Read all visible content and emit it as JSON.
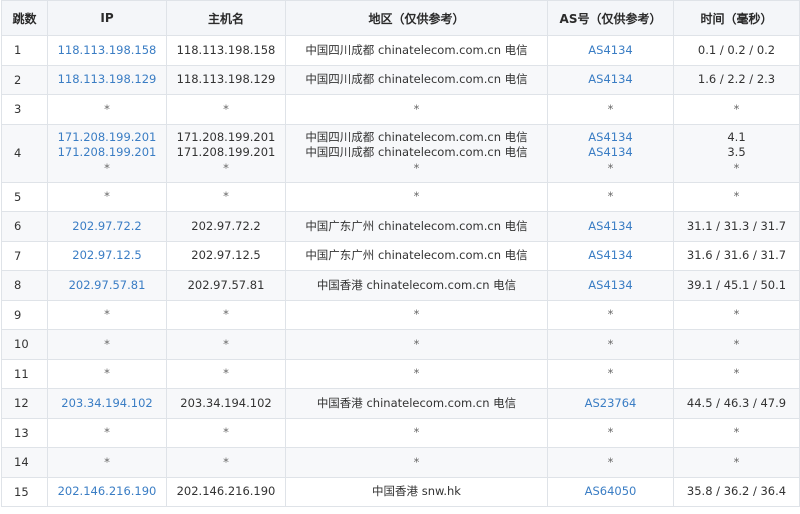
{
  "headers": {
    "hop": "跳数",
    "ip": "IP",
    "host": "主机名",
    "region": "地区（仅供参考）",
    "as": "AS号（仅供参考）",
    "time": "时间（毫秒）"
  },
  "rows": [
    {
      "hop": "1",
      "ip": [
        "118.113.198.158"
      ],
      "host": [
        "118.113.198.158"
      ],
      "region": [
        "中国四川成都 chinatelecom.com.cn 电信"
      ],
      "as": [
        "AS4134"
      ],
      "time": [
        "0.1 / 0.2 / 0.2"
      ]
    },
    {
      "hop": "2",
      "ip": [
        "118.113.198.129"
      ],
      "host": [
        "118.113.198.129"
      ],
      "region": [
        "中国四川成都 chinatelecom.com.cn 电信"
      ],
      "as": [
        "AS4134"
      ],
      "time": [
        "1.6 / 2.2 / 2.3"
      ]
    },
    {
      "hop": "3",
      "ip": [
        "*"
      ],
      "host": [
        "*"
      ],
      "region": [
        "*"
      ],
      "as": [
        "*"
      ],
      "time": [
        "*"
      ]
    },
    {
      "hop": "4",
      "ip": [
        "171.208.199.201",
        "171.208.199.201",
        "*"
      ],
      "host": [
        "171.208.199.201",
        "171.208.199.201",
        "*"
      ],
      "region": [
        "中国四川成都 chinatelecom.com.cn 电信",
        "中国四川成都 chinatelecom.com.cn 电信",
        "*"
      ],
      "as": [
        "AS4134",
        "AS4134",
        "*"
      ],
      "time": [
        "4.1",
        "3.5",
        "*"
      ]
    },
    {
      "hop": "5",
      "ip": [
        "*"
      ],
      "host": [
        "*"
      ],
      "region": [
        "*"
      ],
      "as": [
        "*"
      ],
      "time": [
        "*"
      ]
    },
    {
      "hop": "6",
      "ip": [
        "202.97.72.2"
      ],
      "host": [
        "202.97.72.2"
      ],
      "region": [
        "中国广东广州 chinatelecom.com.cn 电信"
      ],
      "as": [
        "AS4134"
      ],
      "time": [
        "31.1 / 31.3 / 31.7"
      ]
    },
    {
      "hop": "7",
      "ip": [
        "202.97.12.5"
      ],
      "host": [
        "202.97.12.5"
      ],
      "region": [
        "中国广东广州 chinatelecom.com.cn 电信"
      ],
      "as": [
        "AS4134"
      ],
      "time": [
        "31.6 / 31.6 / 31.7"
      ]
    },
    {
      "hop": "8",
      "ip": [
        "202.97.57.81"
      ],
      "host": [
        "202.97.57.81"
      ],
      "region": [
        "中国香港 chinatelecom.com.cn 电信"
      ],
      "as": [
        "AS4134"
      ],
      "time": [
        "39.1 / 45.1 / 50.1"
      ]
    },
    {
      "hop": "9",
      "ip": [
        "*"
      ],
      "host": [
        "*"
      ],
      "region": [
        "*"
      ],
      "as": [
        "*"
      ],
      "time": [
        "*"
      ]
    },
    {
      "hop": "10",
      "ip": [
        "*"
      ],
      "host": [
        "*"
      ],
      "region": [
        "*"
      ],
      "as": [
        "*"
      ],
      "time": [
        "*"
      ]
    },
    {
      "hop": "11",
      "ip": [
        "*"
      ],
      "host": [
        "*"
      ],
      "region": [
        "*"
      ],
      "as": [
        "*"
      ],
      "time": [
        "*"
      ]
    },
    {
      "hop": "12",
      "ip": [
        "203.34.194.102"
      ],
      "host": [
        "203.34.194.102"
      ],
      "region": [
        "中国香港 chinatelecom.com.cn 电信"
      ],
      "as": [
        "AS23764"
      ],
      "time": [
        "44.5 / 46.3 / 47.9"
      ]
    },
    {
      "hop": "13",
      "ip": [
        "*"
      ],
      "host": [
        "*"
      ],
      "region": [
        "*"
      ],
      "as": [
        "*"
      ],
      "time": [
        "*"
      ]
    },
    {
      "hop": "14",
      "ip": [
        "*"
      ],
      "host": [
        "*"
      ],
      "region": [
        "*"
      ],
      "as": [
        "*"
      ],
      "time": [
        "*"
      ]
    },
    {
      "hop": "15",
      "ip": [
        "202.146.216.190"
      ],
      "host": [
        "202.146.216.190"
      ],
      "region": [
        "中国香港 snw.hk"
      ],
      "as": [
        "AS64050"
      ],
      "time": [
        "35.8 / 36.2 / 36.4"
      ]
    }
  ],
  "colors": {
    "link": "#3a7dc4",
    "border": "#dfe3e8",
    "header_bg": "#f4f6f9",
    "stripe_bg": "#f7f8fa"
  }
}
